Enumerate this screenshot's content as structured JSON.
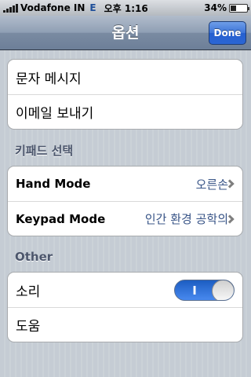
{
  "status_bar": {
    "carrier": "Vodafone IN",
    "network": "E",
    "time": "오후 1:16",
    "battery_percent": "34%",
    "battery_level": 0.34
  },
  "nav": {
    "title": "옵션",
    "done_label": "Done"
  },
  "group_messages": {
    "items": [
      {
        "label": "문자 메시지"
      },
      {
        "label": "이메일 보내기"
      }
    ]
  },
  "keypad_section": {
    "header": "키패드 선택",
    "hand_mode": {
      "label": "Hand Mode",
      "value": "오른손"
    },
    "keypad_mode": {
      "label": "Keypad Mode",
      "value": "인간 환경 공학의"
    }
  },
  "other_section": {
    "header": "Other",
    "sound": {
      "label": "소리",
      "toggle_text": "I",
      "on": true
    },
    "help": {
      "label": "도움"
    }
  },
  "icons": {
    "chevron": "chevron-right-icon",
    "signal": "signal-bars-icon",
    "battery": "battery-icon"
  }
}
